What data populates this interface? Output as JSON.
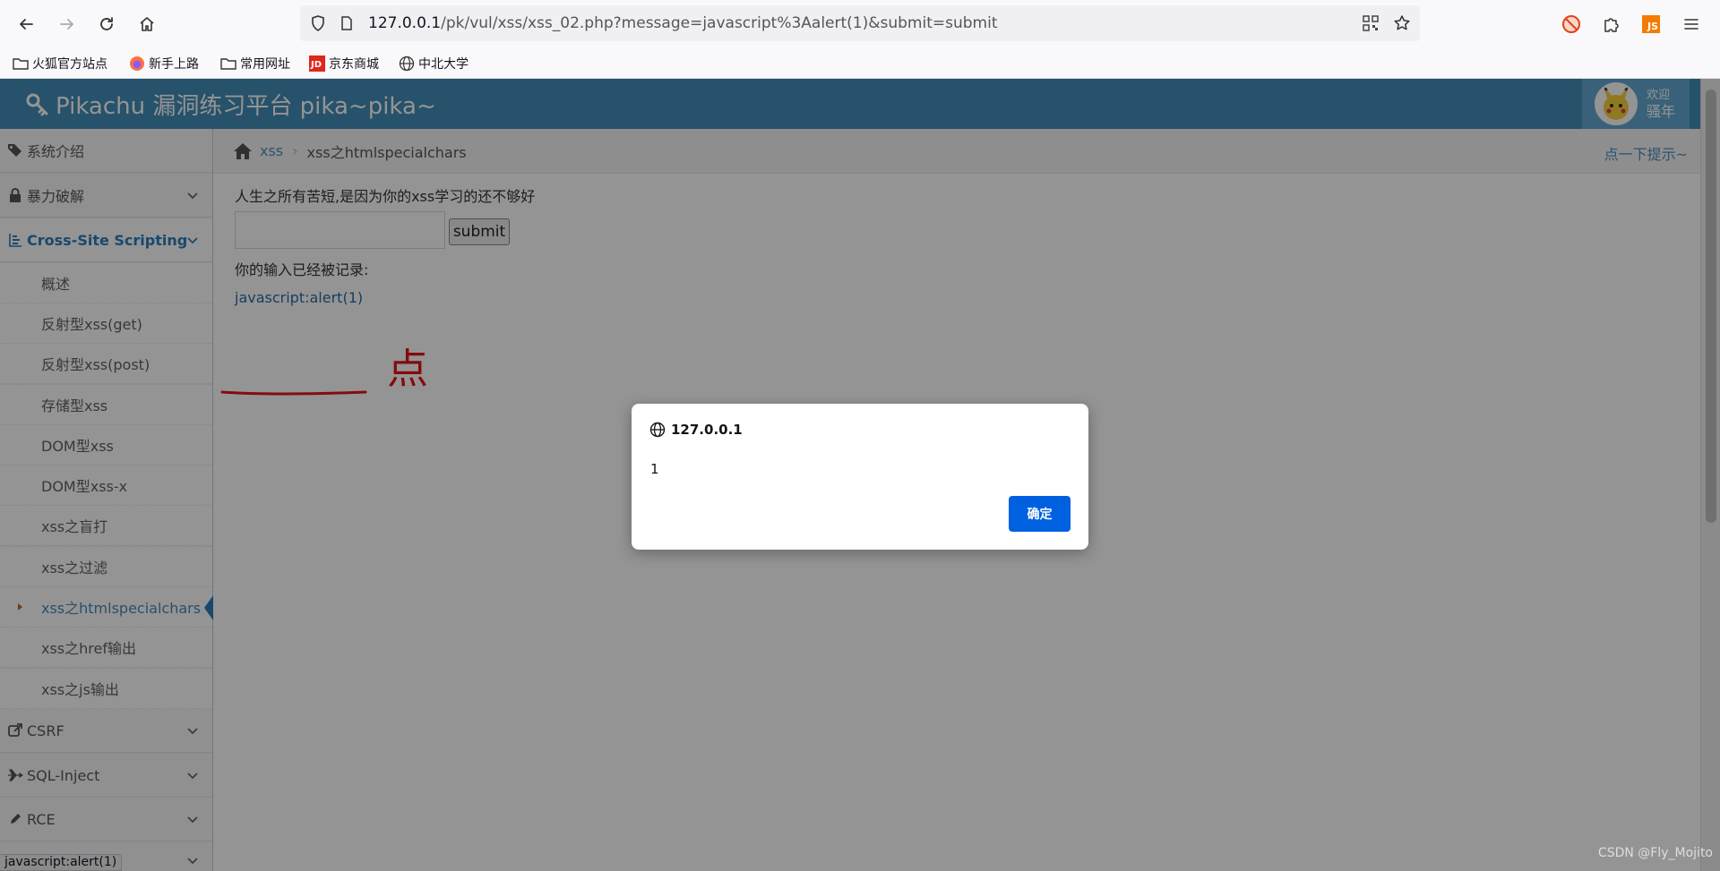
{
  "browser": {
    "url_host": "127.0.0.1",
    "url_path": "/pk/vul/xss/xss_02.php?message=javascript%3Aalert(1)&submit=submit",
    "bookmarks": [
      "火狐官方站点",
      "新手上路",
      "常用网址",
      "京东商城",
      "中北大学"
    ],
    "bookmark_icons": [
      "folder-icon",
      "firefox-icon",
      "folder-icon",
      "jd-icon",
      "globe-icon"
    ],
    "ext_js_label": "JS"
  },
  "header": {
    "brand": "Pikachu 漏洞练习平台 pika~pika~",
    "welcome": "欢迎",
    "username": "骚年",
    "color": "#438eb9"
  },
  "sidebar": {
    "items": [
      {
        "label": "系统介绍",
        "icon": "tag-icon"
      },
      {
        "label": "暴力破解",
        "icon": "lock-icon"
      },
      {
        "label": "Cross-Site Scripting",
        "icon": "list-icon"
      },
      {
        "label": "CSRF",
        "icon": "share-icon"
      },
      {
        "label": "SQL-Inject",
        "icon": "fighter-icon"
      },
      {
        "label": "RCE",
        "icon": "pencil-icon"
      }
    ],
    "xss_sub": [
      "概述",
      "反射型xss(get)",
      "反射型xss(post)",
      "存储型xss",
      "DOM型xss",
      "DOM型xss-x",
      "xss之盲打",
      "xss之过滤",
      "xss之htmlspecialchars",
      "xss之href输出",
      "xss之js输出"
    ]
  },
  "breadcrumb": {
    "link": "xss",
    "current": "xss之htmlspecialchars",
    "hint": "点一下提示~"
  },
  "content": {
    "intro": "人生之所有苦短,是因为你的xss学习的还不够好",
    "input_value": "",
    "submit_label": "submit",
    "record_label": "你的输入已经被记录:",
    "record_link": "javascript:alert(1)",
    "annotation": "点"
  },
  "status_link": "javascript:alert(1)",
  "dialog": {
    "origin": "127.0.0.1",
    "message": "1",
    "ok_label": "确定"
  },
  "watermark": "CSDN @Fly_Mojito"
}
